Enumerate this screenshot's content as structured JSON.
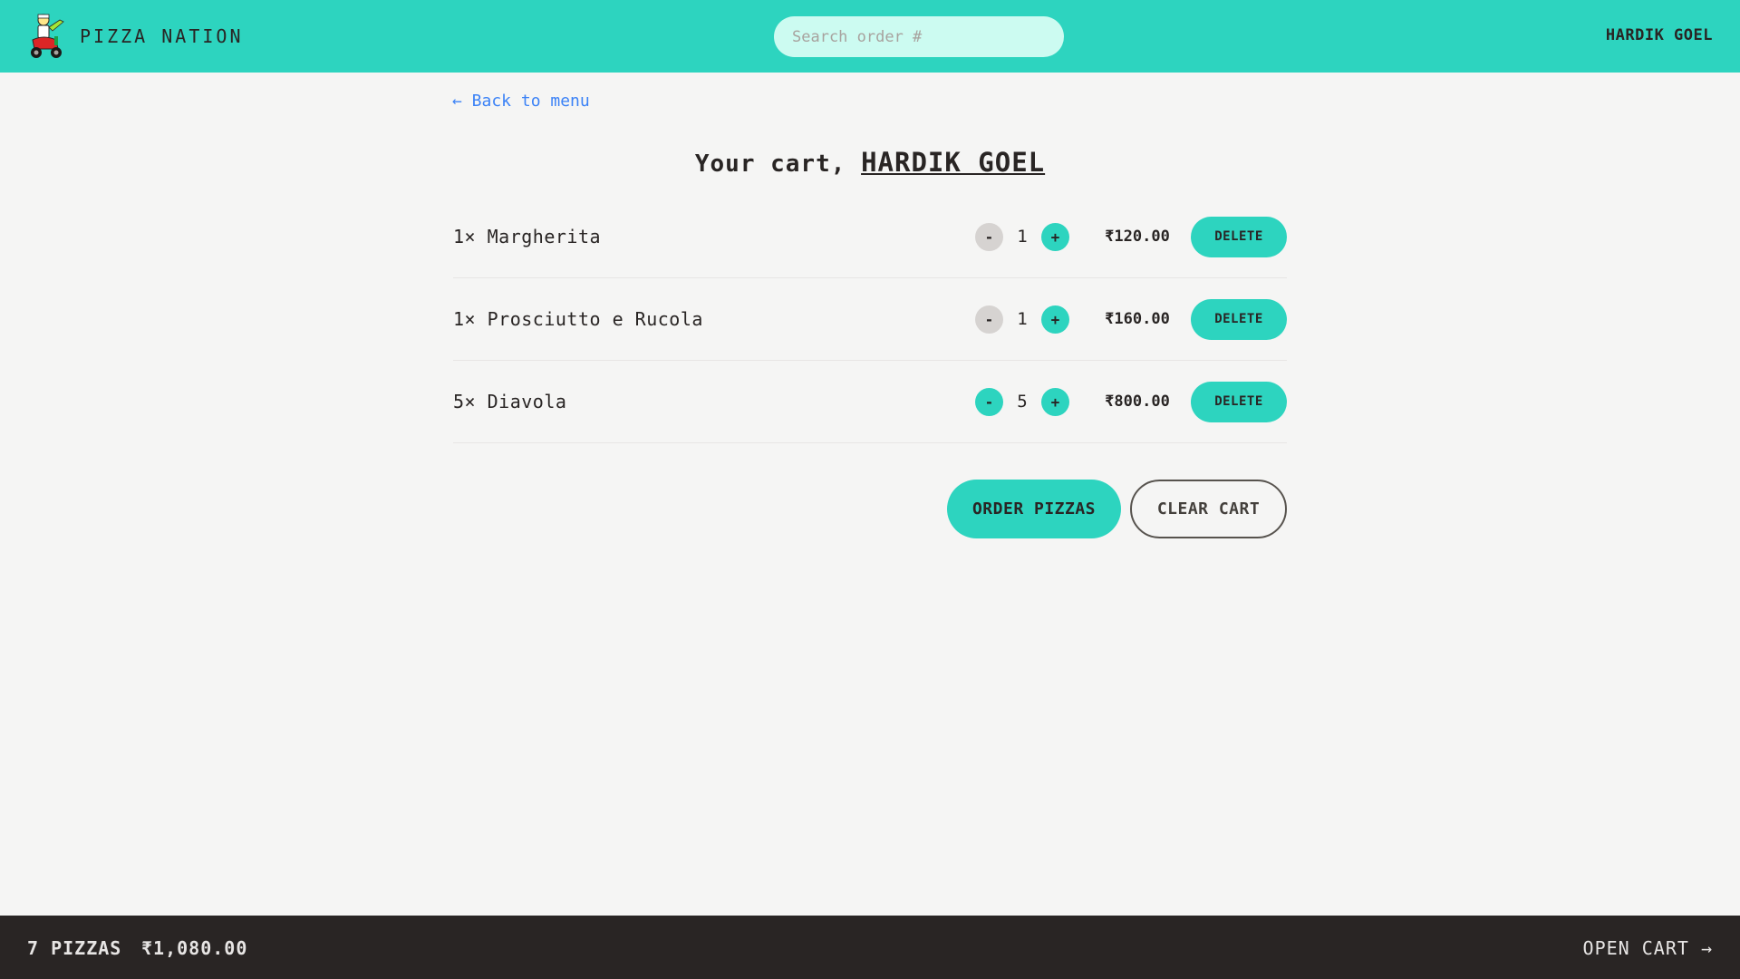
{
  "header": {
    "brand": "PIZZA NATION",
    "search_placeholder": "Search order #",
    "username": "HARDIK GOEL",
    "background": "#2dd4bf"
  },
  "main": {
    "back_link": "← Back to menu",
    "title_prefix": "Your cart,",
    "title_name": "HARDIK GOEL",
    "items": [
      {
        "label": "1× Margherita",
        "quantity": "1",
        "price": "₹120.00",
        "delete_label": "DELETE",
        "minus_enabled": false
      },
      {
        "label": "1× Prosciutto e Rucola",
        "quantity": "1",
        "price": "₹160.00",
        "delete_label": "DELETE",
        "minus_enabled": false
      },
      {
        "label": "5× Diavola",
        "quantity": "5",
        "price": "₹800.00",
        "delete_label": "DELETE",
        "minus_enabled": true
      }
    ],
    "minus_label": "-",
    "plus_label": "+",
    "order_button": "ORDER PIZZAS",
    "clear_button": "CLEAR CART"
  },
  "footer": {
    "count": "7 PIZZAS",
    "total": "₹1,080.00",
    "open_cart": "OPEN CART →"
  },
  "colors": {
    "accent": "#2dd4bf",
    "footer_bg": "#292524",
    "link": "#3b82f6",
    "page_bg": "#f5f5f4"
  },
  "icons": {
    "logo": "pizza-delivery-scooter-icon"
  }
}
